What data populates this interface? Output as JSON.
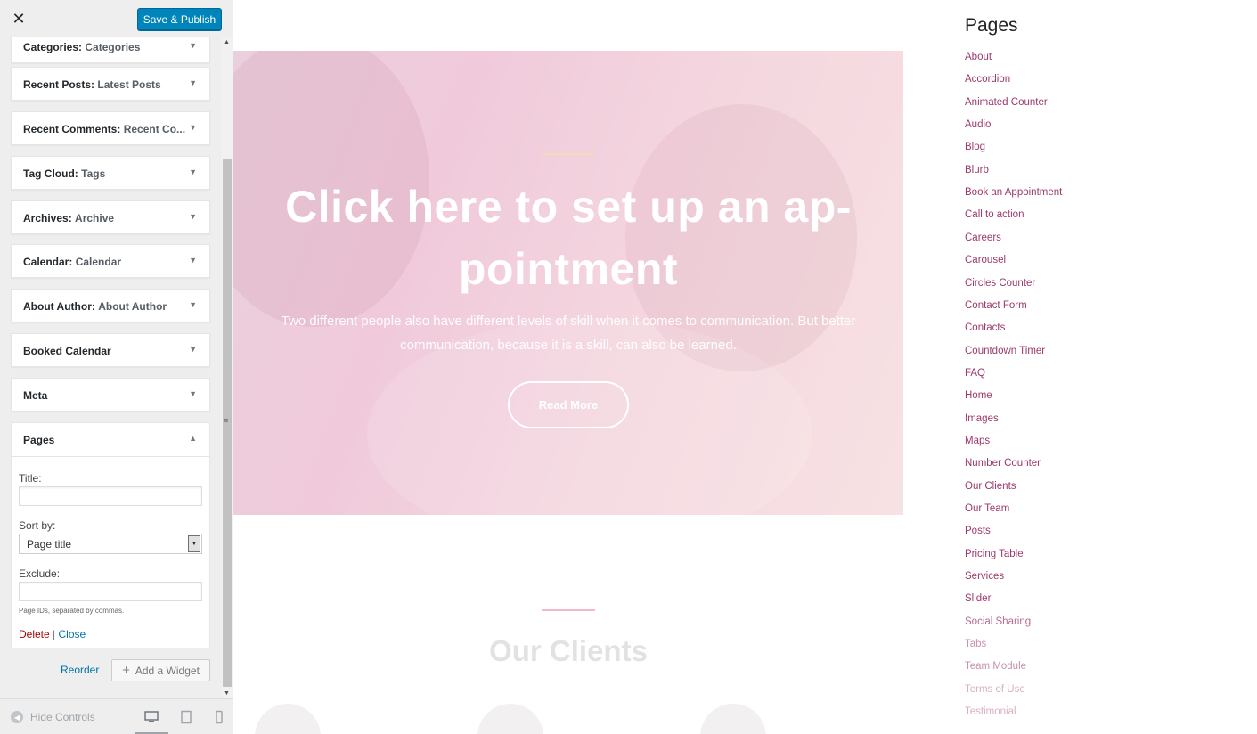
{
  "header": {
    "close_icon": "✕",
    "publish_label": "Save & Publish"
  },
  "widgets": [
    {
      "type": "Categories",
      "title": "Categories"
    },
    {
      "type": "Recent Posts",
      "title": "Latest Posts"
    },
    {
      "type": "Recent Comments",
      "title": "Recent Co..."
    },
    {
      "type": "Tag Cloud",
      "title": "Tags"
    },
    {
      "type": "Archives",
      "title": "Archive"
    },
    {
      "type": "Calendar",
      "title": "Calendar"
    },
    {
      "type": "About Author",
      "title": "About Author"
    },
    {
      "type": "Booked Calendar",
      "title": ""
    },
    {
      "type": "Meta",
      "title": ""
    }
  ],
  "open_widget": {
    "name": "Pages",
    "title_label": "Title:",
    "title_value": "",
    "sortby_label": "Sort by:",
    "sortby_value": "Page title",
    "exclude_label": "Exclude:",
    "exclude_value": "",
    "exclude_hint": "Page IDs, separated by commas.",
    "delete_label": "Delete",
    "separator": "|",
    "close_label": "Close"
  },
  "actions": {
    "reorder_label": "Reorder",
    "add_widget_label": "Add a Widget"
  },
  "footer": {
    "hide_controls_label": "Hide Controls"
  },
  "hero": {
    "title": "Click here to set up an ap-pointment",
    "text": "Two different people also have different levels of skill when it comes to communication. But better communication, because it is a skill, can also be learned.",
    "button_label": "Read More"
  },
  "clients": {
    "title": "Our Clients"
  },
  "pages_widget": {
    "title": "Pages",
    "links": [
      "About",
      "Accordion",
      "Animated Counter",
      "Audio",
      "Blog",
      "Blurb",
      "Book an Appointment",
      "Call to action",
      "Careers",
      "Carousel",
      "Circles Counter",
      "Contact Form",
      "Contacts",
      "Countdown Timer",
      "FAQ",
      "Home",
      "Images",
      "Maps",
      "Number Counter",
      "Our Clients",
      "Our Team",
      "Posts",
      "Pricing Table",
      "Services",
      "Slider",
      "Social Sharing",
      "Tabs",
      "Team Module",
      "Terms of Use",
      "Testimonial"
    ]
  },
  "colors": {
    "primary_button": "#0085ba",
    "link": "#0073aa",
    "delete": "#aa0000",
    "page_link": "#9c3a6c"
  }
}
